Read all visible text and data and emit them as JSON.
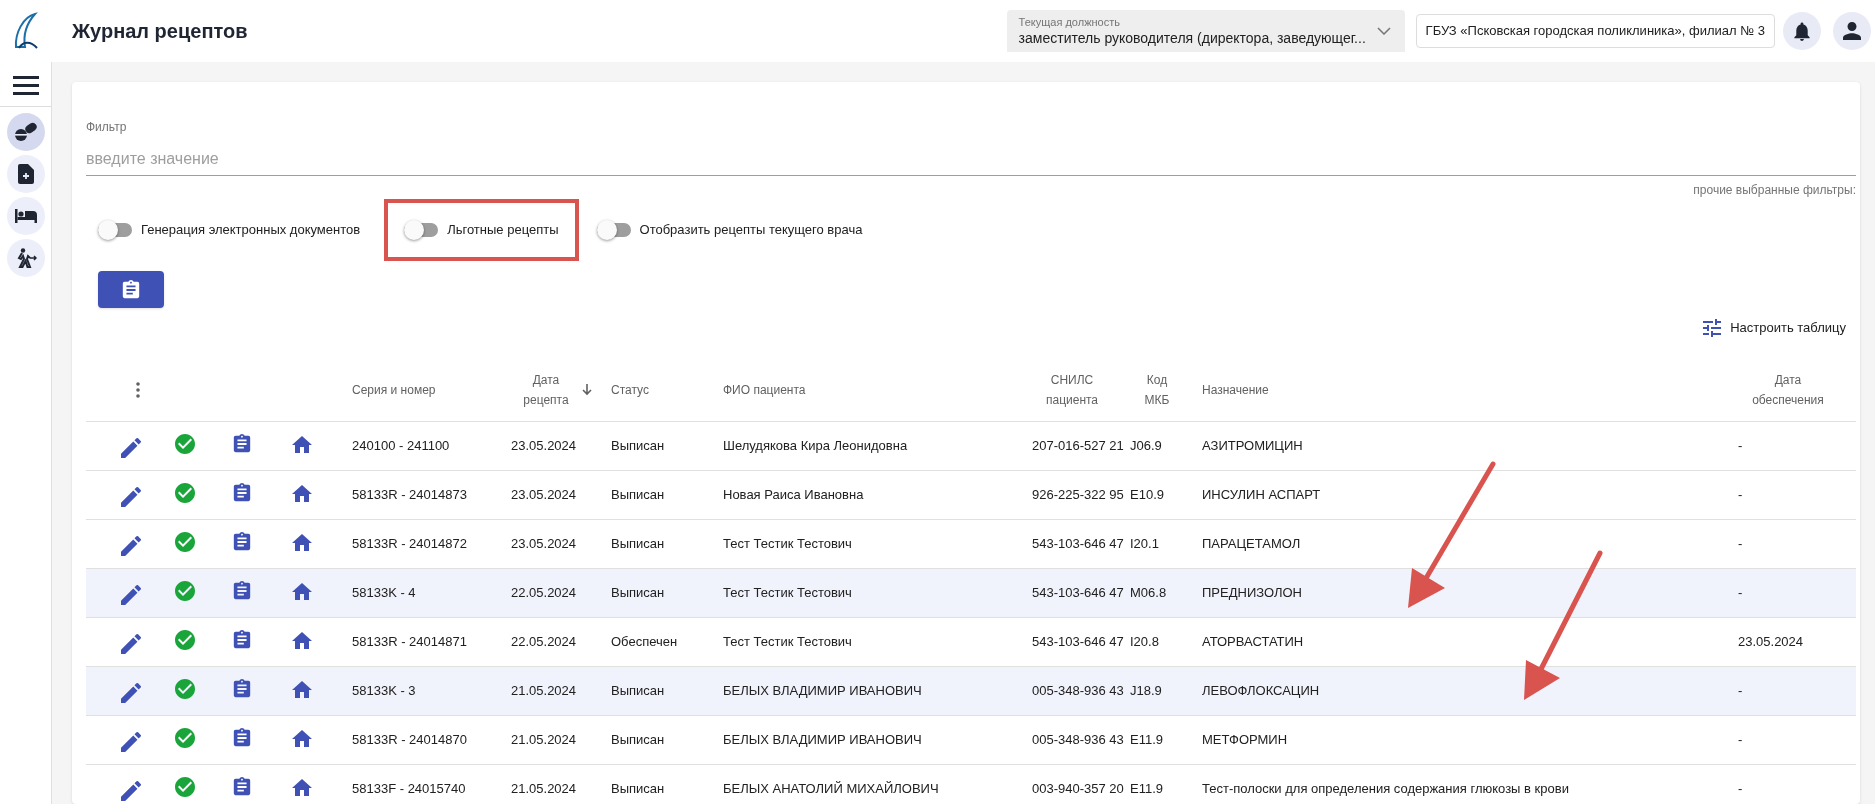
{
  "header": {
    "title": "Журнал рецептов",
    "position": {
      "label": "Текущая должность",
      "value": "заместитель руководителя (директора, заведующег..."
    },
    "organization": "ГБУЗ «Псковская городская поликлиника», филиал № 3"
  },
  "sidebar": {
    "items": [
      {
        "selected": true
      },
      {
        "selected": false
      },
      {
        "selected": false
      },
      {
        "selected": false
      }
    ]
  },
  "filter": {
    "label": "Фильтр",
    "placeholder": "введите значение",
    "other_filters": "прочие выбранные фильтры:"
  },
  "toggles": [
    {
      "label": "Генерация электронных документов",
      "on": false,
      "highlighted": false
    },
    {
      "label": "Льготные рецепты",
      "on": false,
      "highlighted": true
    },
    {
      "label": "Отобразить рецепты текущего врача",
      "on": false,
      "highlighted": false
    }
  ],
  "configure_table": "Настроить таблицу",
  "table": {
    "columns": [
      {
        "label": "Серия и номер",
        "sorted": false
      },
      {
        "label": "Дата рецепта",
        "sorted": true
      },
      {
        "label": "Статус",
        "sorted": false
      },
      {
        "label": "ФИО пациента",
        "sorted": false
      },
      {
        "label": "СНИЛС пациента",
        "sorted": false
      },
      {
        "label": "Код МКБ",
        "sorted": false
      },
      {
        "label": "Назначение",
        "sorted": false
      },
      {
        "label": "Дата обеспечения",
        "sorted": false
      }
    ],
    "rows": [
      {
        "highlighted": false,
        "cells": [
          "240100 - 241100",
          "23.05.2024",
          "Выписан",
          "Шелудякова Кира Леонидовна",
          "207-016-527 21",
          "J06.9",
          "АЗИТРОМИЦИН",
          "-"
        ]
      },
      {
        "highlighted": false,
        "cells": [
          "58133R - 24014873",
          "23.05.2024",
          "Выписан",
          "Новая Раиса Ивановна",
          "926-225-322 95",
          "E10.9",
          "ИНСУЛИН АСПАРТ",
          "-"
        ]
      },
      {
        "highlighted": false,
        "cells": [
          "58133R - 24014872",
          "23.05.2024",
          "Выписан",
          "Тест Тестик Тестович",
          "543-103-646 47",
          "I20.1",
          "ПАРАЦЕТАМОЛ",
          "-"
        ]
      },
      {
        "highlighted": true,
        "cells": [
          "58133K - 4",
          "22.05.2024",
          "Выписан",
          "Тест Тестик Тестович",
          "543-103-646 47",
          "M06.8",
          "ПРЕДНИЗОЛОН",
          "-"
        ]
      },
      {
        "highlighted": false,
        "cells": [
          "58133R - 24014871",
          "22.05.2024",
          "Обеспечен",
          "Тест Тестик Тестович",
          "543-103-646 47",
          "I20.8",
          "АТОРВАСТАТИН",
          "23.05.2024"
        ]
      },
      {
        "highlighted": true,
        "cells": [
          "58133K - 3",
          "21.05.2024",
          "Выписан",
          "БЕЛЫХ ВЛАДИМИР ИВАНОВИЧ",
          "005-348-936 43",
          "J18.9",
          "ЛЕВОФЛОКСАЦИН",
          "-"
        ]
      },
      {
        "highlighted": false,
        "cells": [
          "58133R - 24014870",
          "21.05.2024",
          "Выписан",
          "БЕЛЫХ ВЛАДИМИР ИВАНОВИЧ",
          "005-348-936 43",
          "E11.9",
          "МЕТФОРМИН",
          "-"
        ]
      },
      {
        "highlighted": false,
        "cells": [
          "58133F - 24015740",
          "21.05.2024",
          "Выписан",
          "БЕЛЫХ АНАТОЛИЙ МИХАЙЛОВИЧ",
          "003-940-357 20",
          "E11.9",
          "Тест-полоски для определения содержания глюкозы в крови",
          "-"
        ]
      }
    ]
  }
}
